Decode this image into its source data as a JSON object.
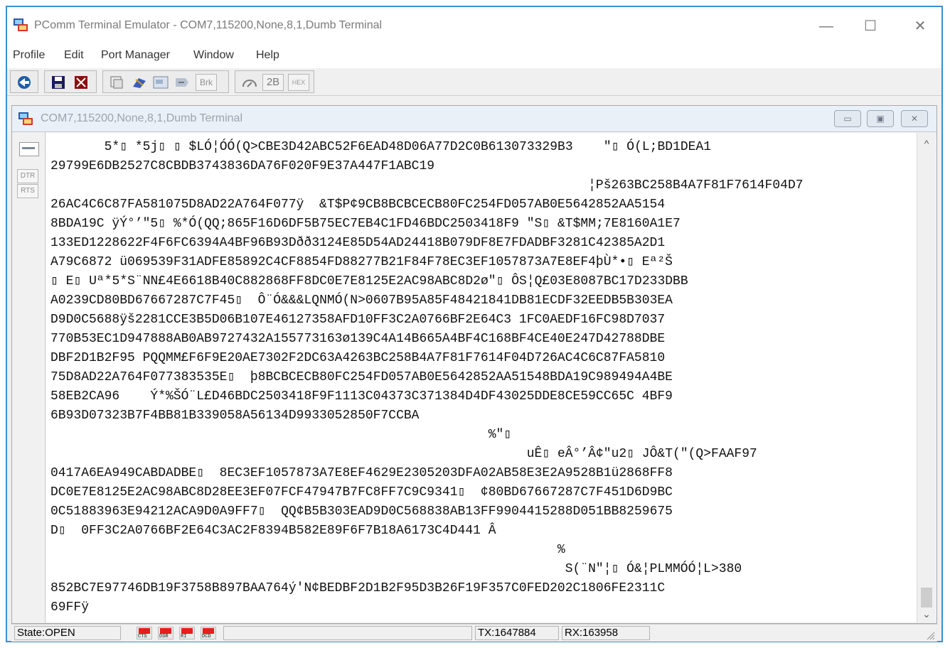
{
  "window": {
    "title": "PComm Terminal Emulator - COM7,115200,None,8,1,Dumb Terminal",
    "minimize": "—",
    "maximize": "☐",
    "close": "✕"
  },
  "menu": [
    "Profile",
    "Edit",
    "Port Manager",
    "Window",
    "Help"
  ],
  "toolbar": {
    "buttons": [
      "connect-icon",
      "save-icon",
      "print-icon",
      "properties-icon",
      "send-file-icon",
      "clear-icon",
      "receive-icon"
    ],
    "brk_label": "Brk",
    "two_b_label": "2B",
    "hex_label": "HEX"
  },
  "child_window": {
    "title": "COM7,115200,None,8,1,Dumb Terminal",
    "buttons": [
      "▭",
      "▣",
      "✕"
    ]
  },
  "side_panel": {
    "dtr_label": "DTR",
    "rts_label": "RTS"
  },
  "terminal": {
    "lines": [
      "       5*▯ *5j▯ ▯ $LÓ¦ÓÓ(Q>CBE3D42ABC52F6EAD48D06A77D2C0B613073329B3    \"▯ Ó(L;BD1DEA1",
      "29799E6DB2527C8CBDB3743836DA76F020F9E37A447F1ABC19",
      "                                                                      ¦Pš263BC258B4A7F81F7614F04D7",
      "26AC4C6C87FA581075D8AD22A764F077ÿ  &T$P¢9CB8BCBCECB80FC254FD057AB0E5642852AA5154",
      "8BDA19C ÿÝ°’\"5▯ %*Ó(QQ;865F16D6DF5B75EC7EB4C1FD46BDC2503418F9 \"S▯ &T$MM;7E8160A1E7",
      "133ED1228622F4F6FC6394A4BF96B93Dðð3124E85D54AD24418B079DF8E7FDADBF3281C42385A2D1",
      "A79C6872 ü069539F31ADFE85892C4CF8854FD88277B21F84F78EC3EF1057873A7E8EF4þÙ*•▯ Eª²Š",
      "▯ E▯ Uª*5*S¨NN£4E6618B40C882868FF8DC0E7E8125E2AC98ABC8D2ø\"▯ ÔS¦Q£03E8087BC17D233DBB",
      "A0239CD80BD67667287C7F45▯  Ô¨Ó&&&LQNMÓ(N>0607B95A85F48421841DB81ECDF32EEDB5B303EA",
      "D9D0C5688ÿš2281CCE3B5D06B107E46127358AFD10FF3C2A0766BF2E64C3 1FC0AEDF16FC98D7037",
      "770B53EC1D947888AB0AB9727432A155773163ø139C4A14B665A4BF4C168BF4CE40E247D42788DBE",
      "DBF2D1B2F95 PQQMM£F6F9E20AE7302F2DC63A4263BC258B4A7F81F7614F04D726AC4C6C87FA5810",
      "75D8AD22A764F077383535E▯  þ8BCBCECB80FC254FD057AB0E5642852AA51548BDA19C989494A4BE",
      "58EB2CA96    Ý*%ŠÓ¨L£D46BDC2503418F9F1113C04373C371384D4DF43025DDE8CE59CC65C 4BF9",
      "6B93D07323B7F4BB81B339058A56134D9933052850F7CCBA",
      "                                                         %\"▯",
      "                                                              uÊ▯ eÂ°’Â¢\"u2▯ JÔ&T(\"(Q>FAAF97",
      "0417A6EA949CABDADBE▯  8EC3EF1057873A7E8EF4629E2305203DFA02AB58E3E2A9528B1ü2868FF8",
      "DC0E7E8125E2AC98ABC8D28EE3EF07FCF47947B7FC8FF7C9C9341▯  ¢80BD67667287C7F451D6D9BC",
      "0C51883963E94212ACA9D0A9FF7▯  QQ¢B5B303EAD9D0C568838AB13FF9904415288D051BB8259675",
      "D▯  0FF3C2A0766BF2E64C3AC2F8394B582E89F6F7B18A6173C4D441 Â",
      "                                                                  %",
      "                                                                   S(¨N\"¦▯ Ó&¦PLMMÓÓ¦L>380",
      "852BC7E97746DB19F3758B897BAA764ý'N¢BEDBF2D1B2F95D3B26F19F357C0FED202C1806FE2311C",
      "69FFÿ"
    ]
  },
  "status": {
    "state": "State:OPEN",
    "leds": [
      "CTS",
      "DSR",
      "RI",
      "DCD"
    ],
    "tx": "TX:1647884",
    "rx": "RX:163958"
  },
  "colors": {
    "window_border": "#3b8fd6",
    "led_red": "#e51e1e"
  }
}
